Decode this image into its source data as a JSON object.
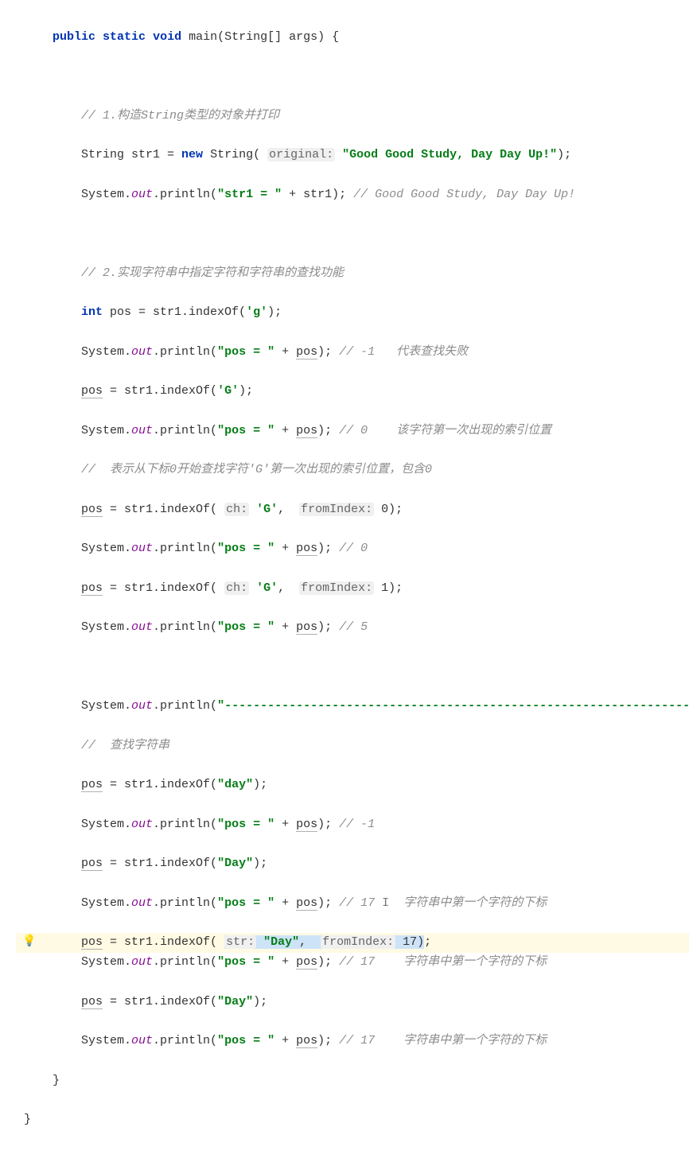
{
  "code": {
    "sig_public": "public",
    "sig_static": "static",
    "sig_void": "void",
    "sig_main": "main",
    "sig_type": "String",
    "sig_args": "[] args) {",
    "c1": "// 1.构造String类型的对象并打印",
    "l2_a": "String",
    "l2_b": " str1 = ",
    "l2_new": "new",
    "l2_c": " String( ",
    "l2_hint": "original:",
    "l2_str": " \"Good Good Study, Day Day Up!\"",
    "l2_d": ");",
    "l3_a": "System.",
    "l3_out": "out",
    "l3_b": ".println(",
    "l3_str": "\"str1 = \"",
    "l3_c": " + str1); ",
    "l3_cm": "// Good Good Study, Day Day Up!",
    "c2": "// 2.实现字符串中指定字符和字符串的查找功能",
    "l5_a": "int",
    "l5_b": " pos = str1.indexOf(",
    "l5_ch": "'g'",
    "l5_c": ");",
    "l6_a": "System.",
    "l6_b": ".println(",
    "l6_str": "\"pos = \"",
    "l6_c": " + ",
    "l6_pos": "pos",
    "l6_d": "); ",
    "l6_cm": "// -1   代表查找失败",
    "l7_a": "pos",
    "l7_b": " = str1.indexOf(",
    "l7_ch": "'G'",
    "l7_c": ");",
    "l8_cm": "// 0    该字符第一次出现的索引位置",
    "c3": "//  表示从下标0开始查找字符'G'第一次出现的索引位置，包含0",
    "l10_a": "pos",
    "l10_b": " = str1.indexOf( ",
    "l10_h1": "ch:",
    "l10_ch": " 'G'",
    "l10_c": ",  ",
    "l10_h2": "fromIndex:",
    "l10_n": " 0",
    "l10_d": ");",
    "l11_cm": "// 0",
    "l12_n": " 1",
    "l13_cm": "// 5",
    "sep_str": "\"------------------------------------------------------------------\"",
    "c4": "//  查找字符串",
    "l16_s": "\"day\"",
    "l17_cm": "// -1",
    "l18_s": "\"Day\"",
    "l19_cm": "// 17",
    "l19_cm2": "字符串中第一个字符的下标",
    "l20_h1": "str:",
    "l20_s": " \"Day\"",
    "l20_h2": "fromIndex:",
    "l20_n": " 17",
    "close1": "}",
    "close2": "}"
  }
}
